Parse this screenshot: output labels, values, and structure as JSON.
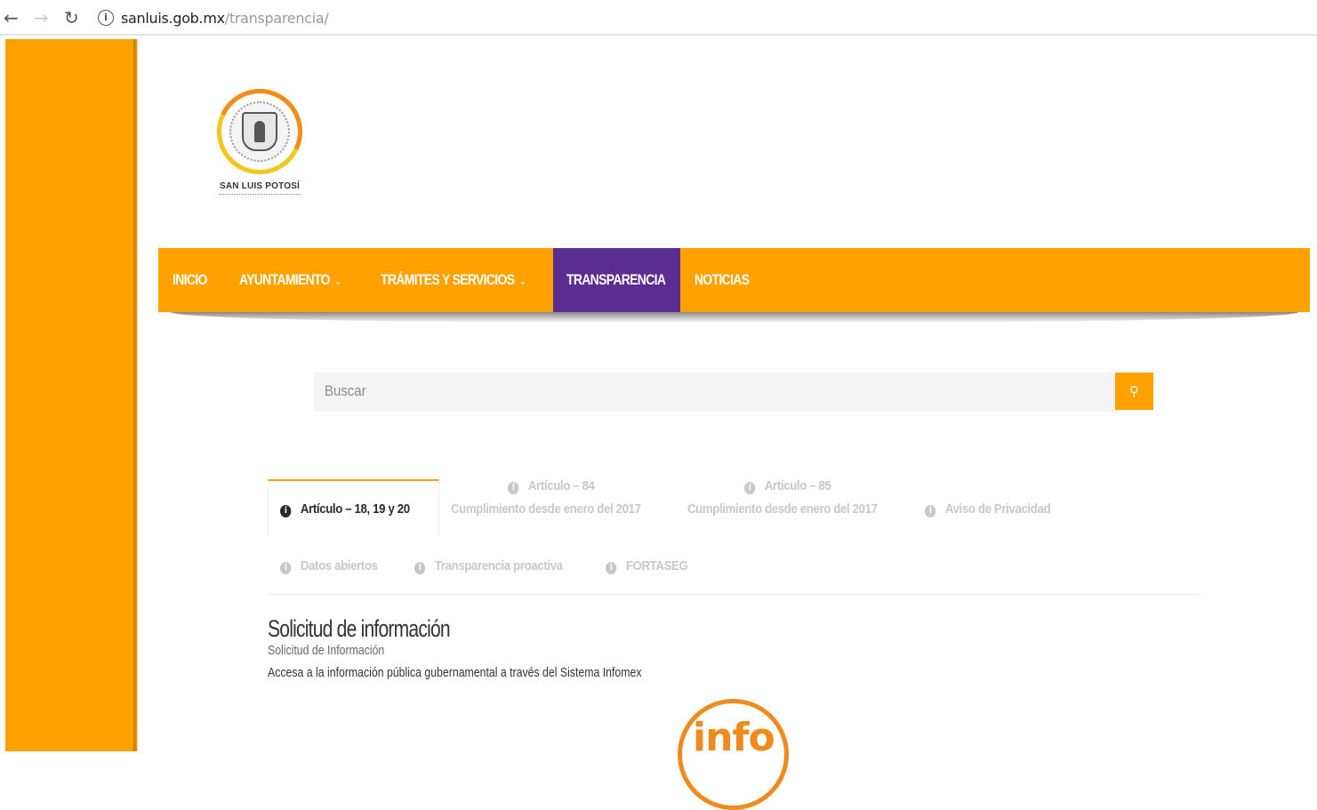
{
  "browser": {
    "url_host": "sanluis.gob.mx",
    "url_path": "/transparencia/"
  },
  "logo": {
    "text": "SAN LUIS POTOSÍ"
  },
  "nav": {
    "items": [
      {
        "label": "INICIO"
      },
      {
        "label": "AYUNTAMIENTO"
      },
      {
        "label": "TRÁMITES Y SERVICIOS"
      },
      {
        "label": "TRANSPARENCIA"
      },
      {
        "label": "NOTICIAS"
      }
    ],
    "active": "TRANSPARENCIA"
  },
  "search": {
    "placeholder": "Buscar"
  },
  "tabs": [
    {
      "label": "Artículo – 18, 19 y 20",
      "active": true
    },
    {
      "label": "Artículo – 84",
      "sublabel": "Cumplimiento desde enero del 2017"
    },
    {
      "label": "Artículo – 85",
      "sublabel": "Cumplimiento desde enero del 2017"
    },
    {
      "label": "Aviso de Privacidad"
    },
    {
      "label": "Datos abiertos"
    },
    {
      "label": "Transparencia proactiva"
    },
    {
      "label": "FORTASEG"
    }
  ],
  "content": {
    "heading": "Solicitud de información",
    "subheading": "Solicitud de Información",
    "description": "Accesa a la información pública gubernamental a través del Sistema Infomex",
    "info_logo_text": "info"
  },
  "colors": {
    "accent": "#ffa200",
    "active_nav": "#5c2d91"
  }
}
